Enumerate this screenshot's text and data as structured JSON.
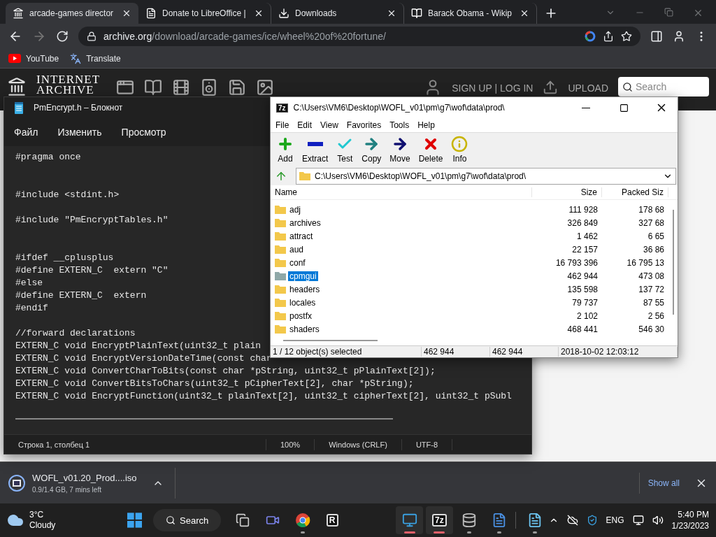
{
  "browser": {
    "tabs": [
      {
        "title": "arcade-games director",
        "kind": "archive",
        "selected": true
      },
      {
        "title": "Donate to LibreOffice |",
        "kind": "page",
        "selected": false
      },
      {
        "title": "Downloads",
        "kind": "download",
        "selected": false
      },
      {
        "title": "Barack Obama - Wikip",
        "kind": "wiki",
        "selected": false
      }
    ],
    "address": {
      "domain": "archive.org",
      "path": "/download/arcade-games/ice/wheel%20of%20fortune/"
    },
    "bookmarks": [
      {
        "label": "YouTube",
        "kind": "youtube"
      },
      {
        "label": "Translate",
        "kind": "translate"
      }
    ]
  },
  "site_header": {
    "logo": "INTERNET ARCHIVE",
    "account": "SIGN UP | LOG IN",
    "upload": "UPLOAD",
    "search": {
      "placeholder": "Search"
    }
  },
  "notepad": {
    "title": "PmEncrypt.h – Блокнот",
    "menu": [
      "Файл",
      "Изменить",
      "Просмотр"
    ],
    "lines": [
      {
        "kind": "code",
        "text": "#pragma once"
      },
      {
        "kind": "blank"
      },
      {
        "kind": "blank"
      },
      {
        "kind": "code",
        "text": "#include <stdint.h>"
      },
      {
        "kind": "blank"
      },
      {
        "kind": "code",
        "text": "#include \"PmEncryptTables.h\""
      },
      {
        "kind": "blank"
      },
      {
        "kind": "blank"
      },
      {
        "kind": "code",
        "text": "#ifdef __cplusplus"
      },
      {
        "kind": "code",
        "text": "#define EXTERN_C  extern \"C\""
      },
      {
        "kind": "code",
        "text": "#else"
      },
      {
        "kind": "code",
        "text": "#define EXTERN_C  extern"
      },
      {
        "kind": "code",
        "text": "#endif"
      },
      {
        "kind": "blank"
      },
      {
        "kind": "code",
        "text": "//forward declarations"
      },
      {
        "kind": "code",
        "text": "EXTERN_C void EncryptPlainText(uint32_t plain"
      },
      {
        "kind": "code",
        "text": "EXTERN_C void EncryptVersionDateTime(const char"
      },
      {
        "kind": "code",
        "text": "EXTERN_C void ConvertCharToBits(const char *pString, uint32_t pPlainText[2]);"
      },
      {
        "kind": "code",
        "text": "EXTERN_C void ConvertBitsToChars(uint32_t pCipherText[2], char *pString);"
      },
      {
        "kind": "code",
        "text": "EXTERN_C void EncryptFunction(uint32_t plainText[2], uint32_t cipherText[2], uint32_t pSubl"
      }
    ],
    "status": [
      "Строка 1, столбец 1",
      "100%",
      "Windows (CRLF)",
      "UTF-8"
    ]
  },
  "archiver": {
    "logo": "7z",
    "title": "C:\\Users\\VM6\\Desktop\\WOFL_v01\\pm\\g7\\wof\\data\\prod\\",
    "menu": [
      "File",
      "Edit",
      "View",
      "Favorites",
      "Tools",
      "Help"
    ],
    "toolbar": [
      {
        "label": "Add",
        "kind": "add"
      },
      {
        "label": "Extract",
        "kind": "extract"
      },
      {
        "label": "Test",
        "kind": "test"
      },
      {
        "label": "Copy",
        "kind": "copy"
      },
      {
        "label": "Move",
        "kind": "move"
      },
      {
        "label": "Delete",
        "kind": "delete"
      },
      {
        "label": "Info",
        "kind": "info"
      }
    ],
    "path": "C:\\Users\\VM6\\Desktop\\WOFL_v01\\pm\\g7\\wof\\data\\prod\\",
    "columns": [
      "Name",
      "Size",
      "Packed Siz"
    ],
    "rows": [
      {
        "name": "adj",
        "size": "111 928",
        "packed": "178 68",
        "selected": false
      },
      {
        "name": "archives",
        "size": "326 849",
        "packed": "327 68",
        "selected": false
      },
      {
        "name": "attract",
        "size": "1 462",
        "packed": "6 65",
        "selected": false
      },
      {
        "name": "aud",
        "size": "22 157",
        "packed": "36 86",
        "selected": false
      },
      {
        "name": "conf",
        "size": "16 793 396",
        "packed": "16 795 13",
        "selected": false
      },
      {
        "name": "cpmgui",
        "size": "462 944",
        "packed": "473 08",
        "selected": true
      },
      {
        "name": "headers",
        "size": "135 598",
        "packed": "137 72",
        "selected": false
      },
      {
        "name": "locales",
        "size": "79 737",
        "packed": "87 55",
        "selected": false
      },
      {
        "name": "postfx",
        "size": "2 102",
        "packed": "2 56",
        "selected": false
      },
      {
        "name": "shaders",
        "size": "468 441",
        "packed": "546 30",
        "selected": false
      }
    ],
    "status": [
      "1 / 12 object(s) selected",
      "462 944",
      "462 944",
      "2018-10-02 12:03:12"
    ]
  },
  "download": {
    "file": "WOFL_v01.20_Prod....iso",
    "progress": "0.9/1.4 GB, 7 mins left",
    "show_all": "Show all"
  },
  "taskbar": {
    "weather": {
      "temp": "3°C",
      "condition": "Cloudy"
    },
    "search": "Search",
    "apps": [
      {
        "kind": "task-view",
        "open": false,
        "focused": false
      },
      {
        "kind": "chat",
        "open": false,
        "focused": false
      },
      {
        "kind": "chrome",
        "open": true,
        "focused": false
      },
      {
        "kind": "letter",
        "text": "R",
        "open": false,
        "focused": false
      },
      {
        "kind": "remote",
        "open": true,
        "focused": true
      },
      {
        "kind": "letter",
        "text": "7z",
        "open": true,
        "focused": true
      },
      {
        "kind": "database",
        "open": true,
        "focused": false
      },
      {
        "kind": "document",
        "open": true,
        "focused": false
      },
      {
        "kind": "notepad",
        "open": true,
        "focused": false
      }
    ],
    "language": "ENG",
    "time": "5:40 PM",
    "date": "1/23/2023"
  }
}
